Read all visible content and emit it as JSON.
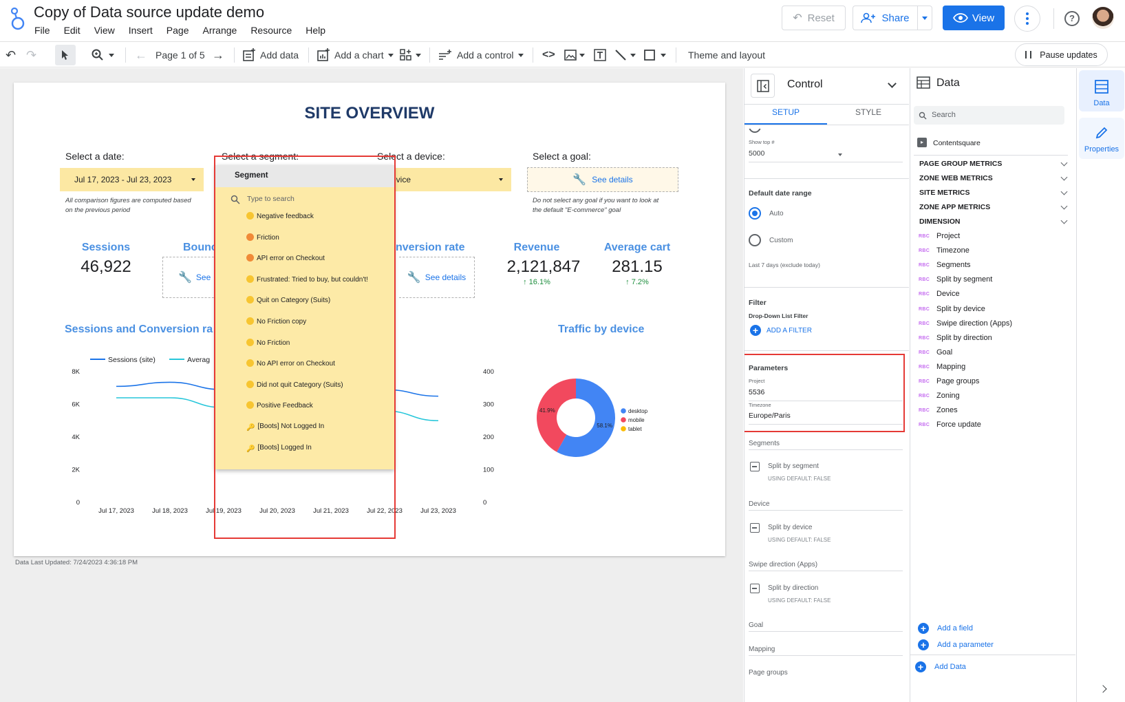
{
  "app": {
    "title": "Copy of Data source update demo",
    "menu": [
      "File",
      "Edit",
      "View",
      "Insert",
      "Page",
      "Arrange",
      "Resource",
      "Help"
    ],
    "reset_label": "Reset",
    "share_label": "Share",
    "view_label": "View"
  },
  "toolbar": {
    "page_label": "Page 1 of 5",
    "add_data": "Add data",
    "add_chart": "Add a chart",
    "add_control": "Add a control",
    "theme": "Theme and layout",
    "pause": "Pause updates"
  },
  "report": {
    "title": "SITE OVERVIEW",
    "date_label": "Select a date:",
    "date_value": "Jul 17, 2023 - Jul 23, 2023",
    "date_note": [
      "All comparison figures are computed based",
      "on the previous period"
    ],
    "segment_label": "Select a segment:",
    "device_label": "Select a device:",
    "device_value": "evice",
    "goal_label": "Select a goal:",
    "see_details": "See details",
    "see_short": "See",
    "goal_note": [
      "Do not select any goal if you want to look at",
      "the default \"E-commerce\" goal"
    ],
    "kpis": {
      "sessions_t": "Sessions",
      "sessions_v": "46,922",
      "bounce_t": "Bounce",
      "conv_t": "nversion rate",
      "revenue_t": "Revenue",
      "revenue_v": "2,121,847",
      "revenue_d": "↑ 16.1%",
      "cart_t": "Average cart",
      "cart_v": "281.15",
      "cart_d": "↑ 7.2%"
    },
    "line_title": "Sessions and Conversion ra",
    "pie_title": "Traffic by device",
    "footer": "Data Last Updated: 7/24/2023 4:36:18 PM"
  },
  "dropdown": {
    "header": "Segment",
    "search_placeholder": "Type to search",
    "items": [
      "Negative feedback",
      "Friction",
      "API error on Checkout",
      "Frustrated: Tried to buy, but couldn't!",
      "Quit on Category (Suits)",
      "No Friction copy",
      "No Friction",
      "No API error on Checkout",
      "Did not quit Category (Suits)",
      "Positive Feedback",
      "[Boots] Not Logged In",
      "[Boots] Logged In"
    ]
  },
  "chart_data": [
    {
      "type": "line",
      "title": "Sessions and Conversion ra",
      "x": [
        "Jul 17, 2023",
        "Jul 18, 2023",
        "Jul 19, 2023",
        "Jul 20, 2023",
        "Jul 21, 2023",
        "Jul 22, 2023",
        "Jul 23, 2023"
      ],
      "series": [
        {
          "name": "Sessions (site)",
          "axis": "left",
          "values": [
            7100,
            7350,
            6900,
            null,
            null,
            6900,
            6500
          ]
        },
        {
          "name": "Averag",
          "axis": "right",
          "values": [
            320,
            320,
            290,
            null,
            null,
            280,
            250
          ]
        }
      ],
      "ylim_left": [
        0,
        8000
      ],
      "yticks_left": [
        "0",
        "2K",
        "4K",
        "6K",
        "8K"
      ],
      "ylim_right": [
        0,
        400
      ],
      "yticks_right": [
        "0",
        "100",
        "200",
        "300",
        "400"
      ],
      "legend": "top",
      "colors": [
        "#1a73e8",
        "#26c6da"
      ]
    },
    {
      "type": "pie",
      "title": "Traffic by device",
      "labels": [
        "desktop",
        "mobile",
        "tablet"
      ],
      "values": [
        58.1,
        41.9,
        0
      ],
      "value_labels": [
        "58.1%",
        "41.9%"
      ],
      "colors": [
        "#4285f4",
        "#f2495e",
        "#fbbc04"
      ],
      "legend": "right"
    }
  ],
  "control_panel": {
    "title": "Control",
    "tab_setup": "SETUP",
    "tab_style": "STYLE",
    "show_top_label": "Show top #",
    "show_top_value": "5000",
    "date_range_h": "Default date range",
    "auto": "Auto",
    "custom": "Custom",
    "last7": "Last 7 days (exclude today)",
    "filter_h": "Filter",
    "filter_sub": "Drop-Down List Filter",
    "add_filter": "ADD A FILTER",
    "params_h": "Parameters",
    "project_label": "Project",
    "project_value": "5536",
    "tz_label": "Timezone",
    "tz_value": "Europe/Paris",
    "segments_h": "Segments",
    "split_segment": "Split by segment",
    "default_false": "USING DEFAULT: FALSE",
    "device_h": "Device",
    "split_device": "Split by device",
    "swipe_h": "Swipe direction (Apps)",
    "split_direction": "Split by direction",
    "goal_h": "Goal",
    "mapping_h": "Mapping",
    "pagegroups_h": "Page groups"
  },
  "data_panel": {
    "title": "Data",
    "search_placeholder": "Search",
    "source": "Contentsquare",
    "groups": [
      "PAGE GROUP METRICS",
      "ZONE WEB METRICS",
      "SITE METRICS",
      "ZONE APP METRICS",
      "DIMENSION"
    ],
    "fields": [
      "Project",
      "Timezone",
      "Segments",
      "Split by segment",
      "Device",
      "Split by device",
      "Swipe direction (Apps)",
      "Split by direction",
      "Goal",
      "Mapping",
      "Page groups",
      "Zoning",
      "Zones",
      "Force update"
    ],
    "abc": "RBC",
    "add_field": "Add a field",
    "add_param": "Add a parameter",
    "add_data": "Add Data"
  },
  "rail": {
    "data": "Data",
    "properties": "Properties"
  }
}
